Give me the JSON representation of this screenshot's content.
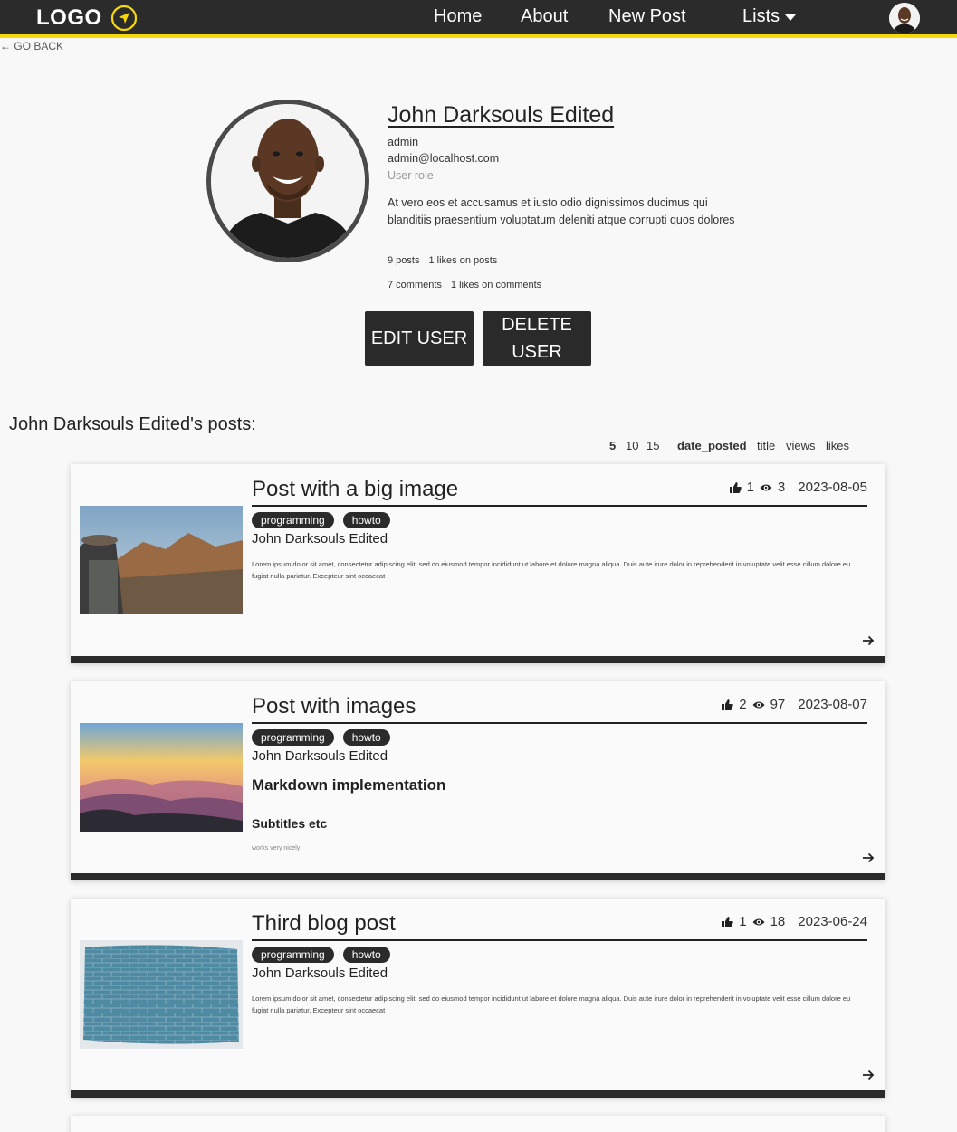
{
  "navbar": {
    "logo_text": "LOGO",
    "links": [
      "Home",
      "About",
      "New Post"
    ],
    "lists_label": "Lists",
    "accent_color": "#f5d90a",
    "bg_color": "#2b2b2b"
  },
  "go_back": "← GO BACK",
  "profile": {
    "name": "John Darksouls Edited",
    "username": "admin",
    "email": "admin@localhost.com",
    "role": "User role",
    "bio": "At vero eos et accusamus et iusto odio dignissimos ducimus qui blanditiis praesentium voluptatum deleniti atque corrupti quos dolores",
    "posts_count": "9 posts",
    "likes_on_posts": "1 likes on posts",
    "comments_count": "7 comments",
    "likes_on_comments": "1 likes on comments",
    "edit_label": "EDIT USER",
    "delete_label": "DELETE USER"
  },
  "posts_heading": "John Darksouls Edited's posts:",
  "controls": {
    "page_sizes": [
      "5",
      "10",
      "15"
    ],
    "sort_options": [
      "date_posted",
      "title",
      "views",
      "likes"
    ]
  },
  "posts": [
    {
      "title": "Post with a big image",
      "likes": "1",
      "views": "3",
      "date": "2023-08-05",
      "tags": [
        "programming",
        "howto"
      ],
      "author": "John Darksouls Edited",
      "excerpt": "Lorem ipsum dolor sit amet, consectetur adipiscing elit, sed do eiusmod tempor incididunt ut labore et dolore magna aliqua. Duis aute irure dolor in reprehenderit in voluptate velit esse cillum dolore eu fugiat nulla pariatur. Excepteur sint occaecat"
    },
    {
      "title": "Post with images",
      "likes": "2",
      "views": "97",
      "date": "2023-08-07",
      "tags": [
        "programming",
        "howto"
      ],
      "author": "John Darksouls Edited",
      "md_heading": "Markdown implementation",
      "md_subtitle": "Subtitles etc",
      "md_small": "works very nicely"
    },
    {
      "title": "Third blog post",
      "likes": "1",
      "views": "18",
      "date": "2023-06-24",
      "tags": [
        "programming",
        "howto"
      ],
      "author": "John Darksouls Edited",
      "excerpt": "Lorem ipsum dolor sit amet, consectetur adipiscing elit, sed do eiusmod tempor incididunt ut labore et dolore magna aliqua. Duis aute irure dolor in reprehenderit in voluptate velit esse cillum dolore eu fugiat nulla pariatur. Excepteur sint occaecat"
    }
  ]
}
